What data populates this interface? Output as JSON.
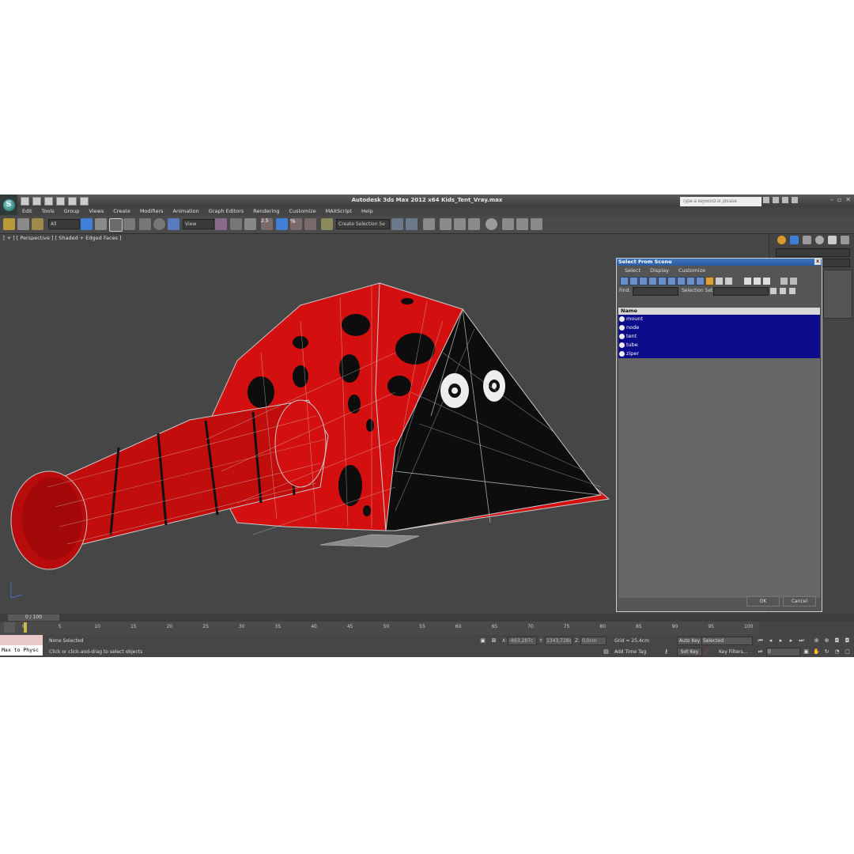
{
  "window": {
    "title": "Autodesk 3ds Max  2012 x64     Kids_Tent_Vray.max",
    "search_placeholder": "Type a keyword or phrase",
    "logo_letter": "S",
    "help_label": "?"
  },
  "menu": [
    "Edit",
    "Tools",
    "Group",
    "Views",
    "Create",
    "Modifiers",
    "Animation",
    "Graph Editors",
    "Rendering",
    "Customize",
    "MAXScript",
    "Help"
  ],
  "toolbar": {
    "filter_value": "All",
    "refcoord_value": "View",
    "selection_set_value": "Create Selection Se",
    "snap_label": "2.5",
    "percent_label": "%"
  },
  "viewport": {
    "label": "[ + ] [ Perspective ] [ Shaded + Edged Faces ]"
  },
  "dialog": {
    "title": "Select From Scene",
    "close_label": "x",
    "menu": [
      "Select",
      "Display",
      "Customize"
    ],
    "find_label": "Find:",
    "selection_set_label": "Selection Set:",
    "column_header": "Name",
    "items": [
      "mount",
      "node",
      "tent",
      "tube",
      "ziper"
    ],
    "ok_label": "OK",
    "cancel_label": "Cancel"
  },
  "timeline": {
    "frame_display": "0 / 100",
    "ticks": [
      "0",
      "5",
      "10",
      "15",
      "20",
      "25",
      "30",
      "35",
      "40",
      "45",
      "50",
      "55",
      "60",
      "65",
      "70",
      "75",
      "80",
      "85",
      "90",
      "95",
      "100"
    ]
  },
  "status": {
    "maxscript_text": "Max to Physc",
    "selection_text": "None Selected",
    "prompt_text": "Click or click-and-drag to select objects",
    "x_label": "X:",
    "x_value": "-863,287c",
    "y_label": "Y:",
    "y_value": "1343,728c",
    "z_label": "Z:",
    "z_value": "0,0cm",
    "grid_text": "Grid = 25,4cm",
    "add_time_tag": "Add Time Tag",
    "auto_key": "Auto Key",
    "selected_value": "Selected",
    "set_key": "Set Key",
    "key_filters": "Key Filters...",
    "frame_value": "0"
  },
  "colors": {
    "tent_red": "#d40f0f",
    "tent_black": "#0d0d0d",
    "selection_blue": "#0c0c8a"
  }
}
